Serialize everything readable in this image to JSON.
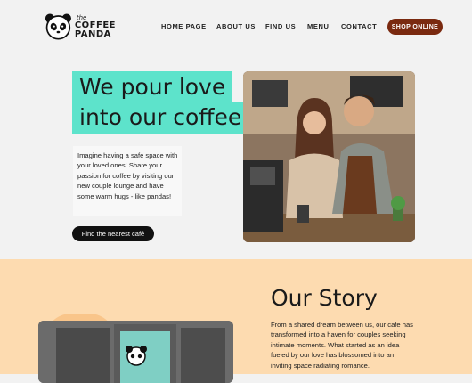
{
  "brand": {
    "the": "the",
    "coffee": "COFFEE",
    "panda": "PANDA"
  },
  "nav": {
    "items": [
      "HOME PAGE",
      "ABOUT US",
      "FIND US",
      "MENU",
      "CONTACT"
    ],
    "shop_label": "SHOP ONLINE"
  },
  "hero": {
    "title_line1": "We pour love",
    "title_line2": "into our coffee",
    "paragraph": "Imagine having a safe space with your loved ones! Share your passion for coffee by visiting our new couple lounge and have some warm hugs - like pandas!",
    "cta_label": "Find the nearest café"
  },
  "story": {
    "title": "Our Story",
    "paragraph": "From a shared dream between us, our cafe has transformed into a haven for couples seeking intimate moments. What started as an idea fueled by our love has blossomed into an inviting space radiating romance."
  },
  "colors": {
    "accent_teal": "#5de3cb",
    "shop_button": "#7a2a10",
    "story_bg": "#fddbb0"
  }
}
